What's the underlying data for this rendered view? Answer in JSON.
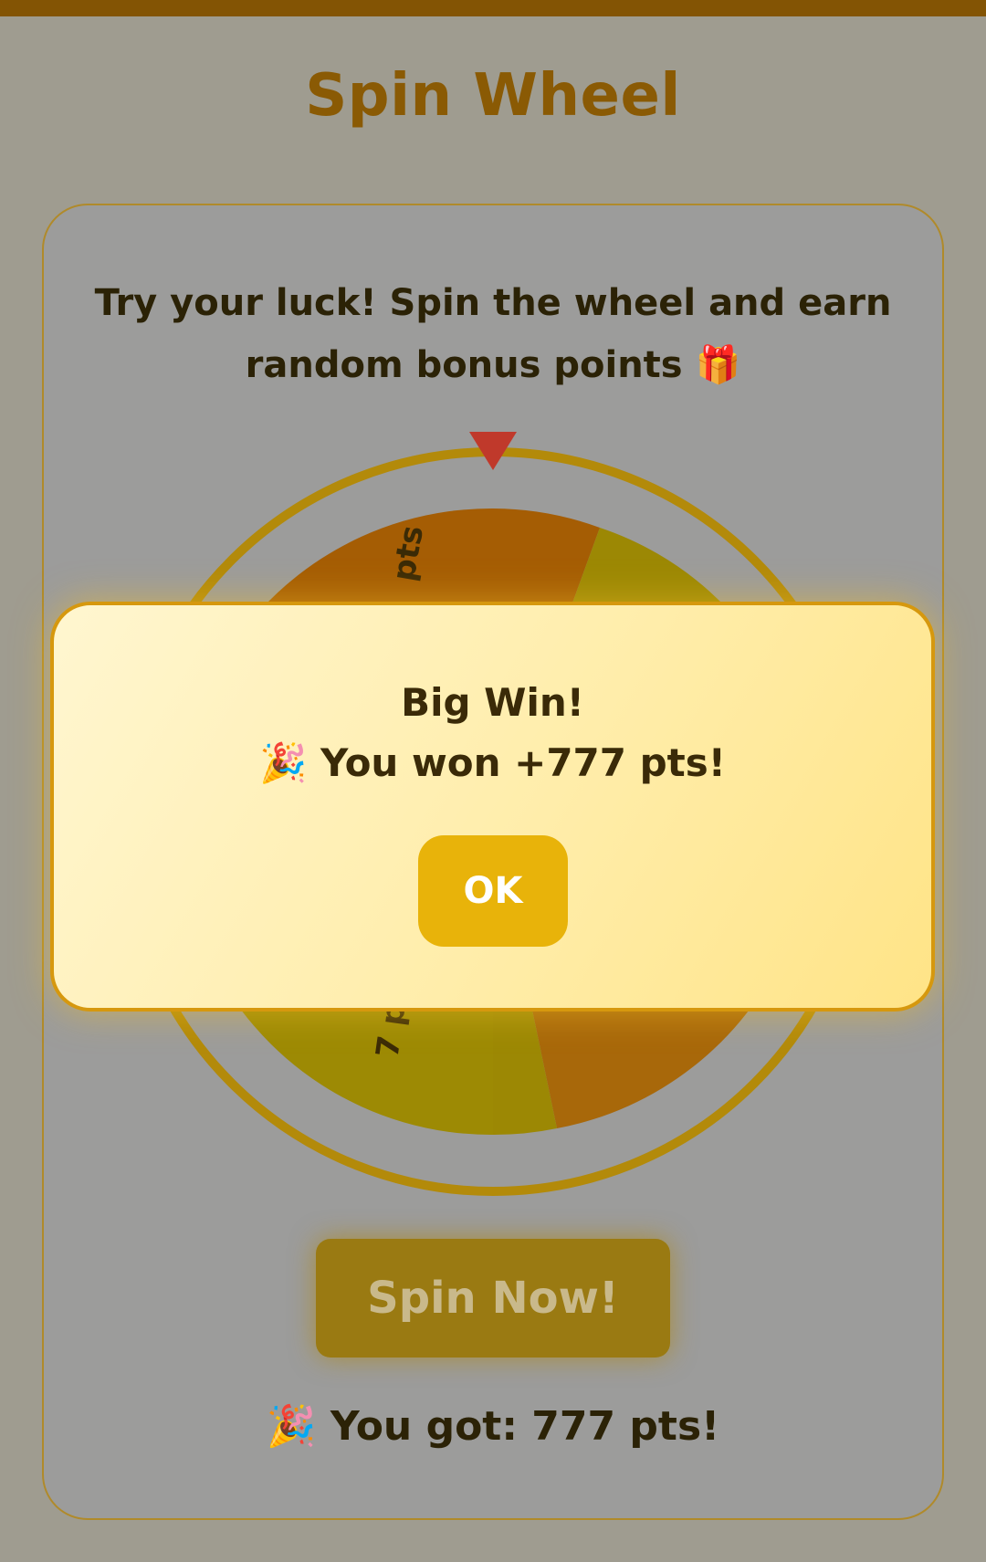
{
  "page": {
    "title": "Spin Wheel"
  },
  "card": {
    "subtitle": "Try your luck! Spin the wheel and earn random bonus points 🎁",
    "spin_button_label": "Spin Now!",
    "result_text": "🎉 You got: 777 pts!"
  },
  "wheel": {
    "segment_labels": [
      "pts",
      "7 pts"
    ],
    "colors": {
      "segment_dark": "#a55d04",
      "segment_light": "#9c8804",
      "rim": "#b38a0a",
      "pointer": "#c0392b"
    }
  },
  "modal": {
    "title": "Big Win!",
    "message": "🎉 You won +777 pts!",
    "ok_label": "OK"
  },
  "colors": {
    "accent": "#e8b30a",
    "title": "#8a5a04",
    "text": "#2b2206"
  }
}
